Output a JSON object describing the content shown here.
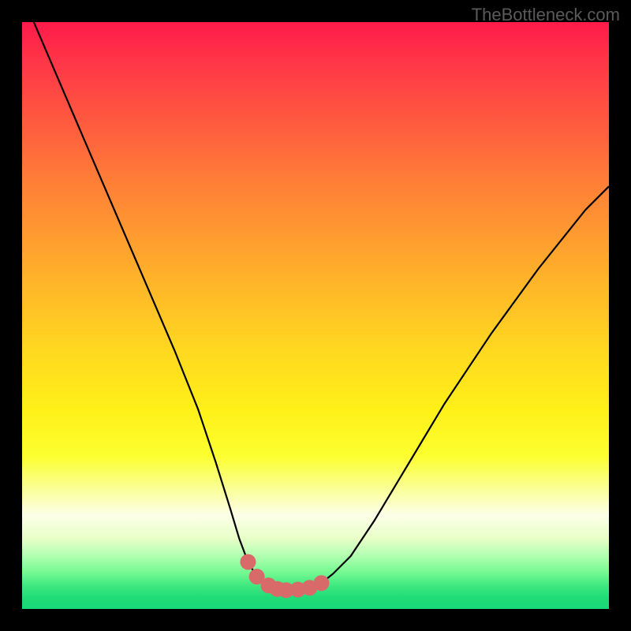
{
  "watermark": "TheBottleneck.com",
  "chart_data": {
    "type": "line",
    "title": "",
    "xlabel": "",
    "ylabel": "",
    "xlim": [
      0,
      100
    ],
    "ylim": [
      0,
      100
    ],
    "series": [
      {
        "name": "curve",
        "x": [
          2,
          8,
          14,
          20,
          26,
          30,
          33,
          35.5,
          37,
          38.5,
          40,
          42,
          43.5,
          45,
          47,
          49,
          51,
          53,
          56,
          60,
          66,
          72,
          80,
          88,
          96,
          100
        ],
        "y": [
          100,
          86,
          72,
          58,
          44,
          34,
          25,
          17,
          12,
          8,
          5.5,
          4,
          3.4,
          3.2,
          3.3,
          3.6,
          4.4,
          6,
          9,
          15,
          25,
          35,
          47,
          58,
          68,
          72
        ]
      },
      {
        "name": "markers",
        "type": "scatter",
        "x": [
          38.5,
          40,
          42,
          43.5,
          45,
          47,
          49,
          51
        ],
        "y": [
          8,
          5.5,
          4,
          3.4,
          3.2,
          3.3,
          3.6,
          4.4
        ]
      }
    ],
    "colors": {
      "curve_stroke": "#000000",
      "marker_fill": "#d86a6a"
    }
  }
}
